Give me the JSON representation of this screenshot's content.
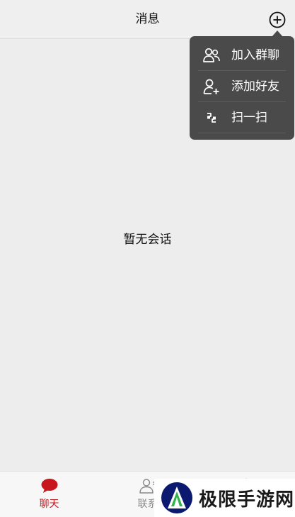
{
  "header": {
    "title": "消息",
    "add_icon": "plus-circle-icon"
  },
  "popup_menu": {
    "items": [
      {
        "label": "加入群聊",
        "icon": "group-icon"
      },
      {
        "label": "添加好友",
        "icon": "add-friend-icon"
      },
      {
        "label": "扫一扫",
        "icon": "scan-icon"
      }
    ]
  },
  "main": {
    "empty_text": "暂无会话"
  },
  "tabbar": {
    "tabs": [
      {
        "label": "聊天",
        "icon": "chat-bubble-icon",
        "active": true
      },
      {
        "label": "联系",
        "icon": "contacts-icon",
        "active": false
      },
      {
        "label": "",
        "icon": "me-icon",
        "active": false
      }
    ]
  },
  "watermark": {
    "text": "极限手游网"
  },
  "colors": {
    "accent": "#c8161d",
    "background": "#ededed",
    "popup_bg": "#4a4a4a",
    "inactive_tab": "#888888"
  }
}
